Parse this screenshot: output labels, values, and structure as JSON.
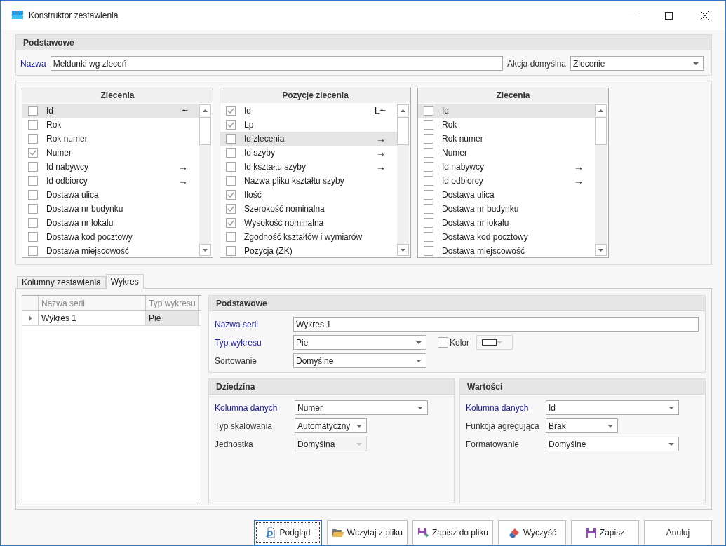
{
  "window": {
    "title": "Konstruktor zestawienia"
  },
  "basic": {
    "title": "Podstawowe",
    "name_label": "Nazwa",
    "name_value": "Meldunki wg zleceń",
    "action_label": "Akcja domyślna",
    "action_value": "Zlecenie"
  },
  "lists": [
    {
      "title": "Zlecenia",
      "items": [
        {
          "label": "Id",
          "checked": false,
          "selected": true,
          "marker": "~"
        },
        {
          "label": "Rok",
          "checked": false,
          "selected": false
        },
        {
          "label": "Rok numer",
          "checked": false,
          "selected": false
        },
        {
          "label": "Numer",
          "checked": true,
          "selected": false
        },
        {
          "label": "Id nabywcy",
          "checked": false,
          "selected": false,
          "marker": "→"
        },
        {
          "label": "Id odbiorcy",
          "checked": false,
          "selected": false,
          "marker": "→"
        },
        {
          "label": "Dostawa ulica",
          "checked": false,
          "selected": false
        },
        {
          "label": "Dostawa nr budynku",
          "checked": false,
          "selected": false
        },
        {
          "label": "Dostawa nr lokalu",
          "checked": false,
          "selected": false
        },
        {
          "label": "Dostawa kod pocztowy",
          "checked": false,
          "selected": false
        },
        {
          "label": "Dostawa miejscowość",
          "checked": false,
          "selected": false
        }
      ]
    },
    {
      "title": "Pozycje zlecenia",
      "items": [
        {
          "label": "Id",
          "checked": true,
          "selected": false,
          "marker": "L~"
        },
        {
          "label": "Lp",
          "checked": true,
          "selected": false
        },
        {
          "label": "Id zlecenia",
          "checked": false,
          "selected": true,
          "marker": "→"
        },
        {
          "label": "Id szyby",
          "checked": false,
          "selected": false,
          "marker": "→"
        },
        {
          "label": "Id kształtu szyby",
          "checked": false,
          "selected": false,
          "marker": "→"
        },
        {
          "label": "Nazwa pliku kształtu szyby",
          "checked": false,
          "selected": false
        },
        {
          "label": "Ilość",
          "checked": true,
          "selected": false
        },
        {
          "label": "Szerokość nominalna",
          "checked": true,
          "selected": false
        },
        {
          "label": "Wysokość nominalna",
          "checked": true,
          "selected": false
        },
        {
          "label": "Zgodność kształtów i wymiarów",
          "checked": false,
          "selected": false
        },
        {
          "label": "Pozycja (ZK)",
          "checked": false,
          "selected": false
        }
      ]
    },
    {
      "title": "Zlecenia",
      "items": [
        {
          "label": "Id",
          "checked": false,
          "selected": true
        },
        {
          "label": "Rok",
          "checked": false,
          "selected": false
        },
        {
          "label": "Rok numer",
          "checked": false,
          "selected": false
        },
        {
          "label": "Numer",
          "checked": false,
          "selected": false
        },
        {
          "label": "Id nabywcy",
          "checked": false,
          "selected": false,
          "marker": "→"
        },
        {
          "label": "Id odbiorcy",
          "checked": false,
          "selected": false,
          "marker": "→"
        },
        {
          "label": "Dostawa ulica",
          "checked": false,
          "selected": false
        },
        {
          "label": "Dostawa nr budynku",
          "checked": false,
          "selected": false
        },
        {
          "label": "Dostawa nr lokalu",
          "checked": false,
          "selected": false
        },
        {
          "label": "Dostawa kod pocztowy",
          "checked": false,
          "selected": false
        },
        {
          "label": "Dostawa miejscowość",
          "checked": false,
          "selected": false
        }
      ]
    }
  ],
  "tabs": [
    {
      "label": "Kolumny zestawienia",
      "selected": false
    },
    {
      "label": "Wykres",
      "selected": true
    }
  ],
  "series_grid": {
    "columns": [
      "Nazwa serii",
      "Typ wykresu"
    ],
    "rows": [
      {
        "cells": [
          "Wykres 1",
          "Pie"
        ],
        "selected": true
      }
    ]
  },
  "series_basic": {
    "title": "Podstawowe",
    "fields": [
      {
        "kind": "text",
        "label": "Nazwa serii",
        "value": "Wykres 1",
        "required": true,
        "disabled": false
      },
      {
        "kind": "select",
        "label": "Typ wykresu",
        "value": "Pie",
        "required": true,
        "disabled": false
      },
      {
        "kind": "select",
        "label": "Sortowanie",
        "value": "Domyślne",
        "required": false,
        "disabled": false
      }
    ],
    "color_option": {
      "label": "Kolor",
      "checked": false,
      "color": "#ffffff"
    }
  },
  "domain": {
    "title": "Dziedzina",
    "fields": [
      {
        "kind": "select",
        "label": "Kolumna danych",
        "value": "Numer",
        "required": true,
        "disabled": false
      },
      {
        "kind": "select",
        "label": "Typ skalowania",
        "value": "Automatyczny",
        "required": false,
        "disabled": false
      },
      {
        "kind": "select",
        "label": "Jednostka",
        "value": "Domyślna",
        "required": false,
        "disabled": true
      }
    ]
  },
  "values": {
    "title": "Wartości",
    "fields": [
      {
        "kind": "select",
        "label": "Kolumna danych",
        "value": "Id",
        "required": true,
        "disabled": false
      },
      {
        "kind": "select",
        "label": "Funkcja agregująca",
        "value": "Brak",
        "required": false,
        "disabled": false
      },
      {
        "kind": "select",
        "label": "Formatowanie",
        "value": "Domyślne",
        "required": false,
        "disabled": false
      }
    ]
  },
  "buttons": [
    {
      "label": "Podgląd",
      "kind": "preview",
      "focused": true
    },
    {
      "label": "Wczytaj z pliku",
      "kind": "open",
      "focused": false
    },
    {
      "label": "Zapisz do pliku",
      "kind": "export",
      "focused": false
    },
    {
      "label": "Wyczyść",
      "kind": "erase",
      "focused": false
    },
    {
      "label": "Zapisz",
      "kind": "save",
      "focused": false
    },
    {
      "label": "Anuluj",
      "kind": "plain",
      "focused": false
    }
  ]
}
